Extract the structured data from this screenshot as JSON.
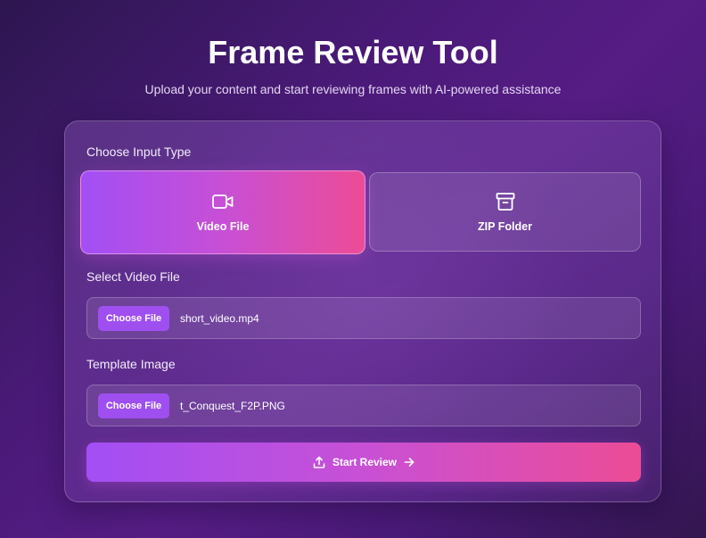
{
  "header": {
    "title": "Frame Review Tool",
    "subtitle": "Upload your content and start reviewing frames with AI-powered assistance"
  },
  "form": {
    "input_type_label": "Choose Input Type",
    "input_types": [
      {
        "label": "Video File",
        "icon": "video-camera-icon",
        "selected": true
      },
      {
        "label": "ZIP Folder",
        "icon": "archive-box-icon",
        "selected": false
      }
    ],
    "video_file": {
      "label": "Select Video File",
      "button_label": "Choose File",
      "value": "short_video.mp4"
    },
    "template_image": {
      "label": "Template Image",
      "button_label": "Choose File",
      "value": "t_Conquest_F2P.PNG"
    },
    "submit": {
      "label": "Start Review",
      "left_icon": "upload-icon",
      "right_icon": "arrow-right-icon"
    }
  },
  "colors": {
    "accent_start": "#a24ff5",
    "accent_end": "#ec4c96",
    "background": "#4a1a78",
    "choose_button": "#9f4ff0"
  }
}
